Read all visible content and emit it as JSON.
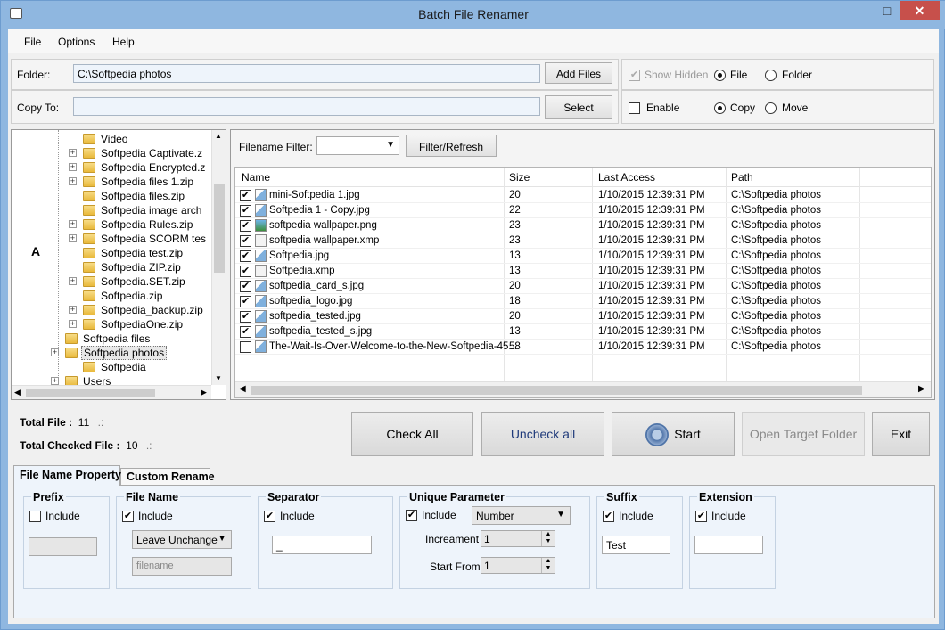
{
  "window": {
    "title": "Batch File Renamer",
    "min": "–",
    "max": "□",
    "close": "✕"
  },
  "menu": [
    "File",
    "Options",
    "Help"
  ],
  "folder": {
    "label": "Folder:",
    "value": "C:\\Softpedia photos",
    "add_button": "Add Files"
  },
  "copyto": {
    "label": "Copy To:",
    "value": "",
    "select_button": "Select"
  },
  "options": {
    "show_hidden": "Show Hidden",
    "file": "File",
    "folder": "Folder",
    "enable": "Enable",
    "copy": "Copy",
    "move": "Move"
  },
  "tree": {
    "marker": "A",
    "items": [
      {
        "label": "Video",
        "expander": false
      },
      {
        "label": "Softpedia Captivate.z",
        "expander": true
      },
      {
        "label": "Softpedia Encrypted.z",
        "expander": true
      },
      {
        "label": "Softpedia files 1.zip",
        "expander": true
      },
      {
        "label": "Softpedia files.zip",
        "expander": false
      },
      {
        "label": "Softpedia image arch",
        "expander": false
      },
      {
        "label": "Softpedia Rules.zip",
        "expander": true
      },
      {
        "label": "Softpedia SCORM tes",
        "expander": true
      },
      {
        "label": "Softpedia test.zip",
        "expander": false
      },
      {
        "label": "Softpedia ZIP.zip",
        "expander": false
      },
      {
        "label": "Softpedia.SET.zip",
        "expander": true
      },
      {
        "label": "Softpedia.zip",
        "expander": false
      },
      {
        "label": "Softpedia_backup.zip",
        "expander": true
      },
      {
        "label": "SoftpediaOne.zip",
        "expander": true
      },
      {
        "label": "Softpedia files",
        "expander": false
      },
      {
        "label": "Softpedia photos",
        "expander": true,
        "selected": true
      },
      {
        "label": "Softpedia",
        "expander": false
      },
      {
        "label": "Users",
        "expander": true
      }
    ]
  },
  "filter": {
    "label": "Filename Filter:",
    "value": "",
    "button": "Filter/Refresh"
  },
  "grid": {
    "columns": [
      "Name",
      "Size",
      "Last Access",
      "Path"
    ],
    "rows": [
      {
        "checked": true,
        "icon": "image-file-icon",
        "name": "mini-Softpedia 1.jpg",
        "size": "20",
        "access": "1/10/2015 12:39:31 PM",
        "path": "C:\\Softpedia photos"
      },
      {
        "checked": true,
        "icon": "image-file-icon",
        "name": "Softpedia 1 - Copy.jpg",
        "size": "22",
        "access": "1/10/2015 12:39:31 PM",
        "path": "C:\\Softpedia photos"
      },
      {
        "checked": true,
        "icon": "png-file-icon",
        "name": "softpedia wallpaper.png",
        "size": "23",
        "access": "1/10/2015 12:39:31 PM",
        "path": "C:\\Softpedia photos"
      },
      {
        "checked": true,
        "icon": "blank-file-icon",
        "name": "softpedia wallpaper.xmp",
        "size": "23",
        "access": "1/10/2015 12:39:31 PM",
        "path": "C:\\Softpedia photos"
      },
      {
        "checked": true,
        "icon": "image-file-icon",
        "name": "Softpedia.jpg",
        "size": "13",
        "access": "1/10/2015 12:39:31 PM",
        "path": "C:\\Softpedia photos"
      },
      {
        "checked": true,
        "icon": "blank-file-icon",
        "name": "Softpedia.xmp",
        "size": "13",
        "access": "1/10/2015 12:39:31 PM",
        "path": "C:\\Softpedia photos"
      },
      {
        "checked": true,
        "icon": "image-file-icon",
        "name": "softpedia_card_s.jpg",
        "size": "20",
        "access": "1/10/2015 12:39:31 PM",
        "path": "C:\\Softpedia photos"
      },
      {
        "checked": true,
        "icon": "image-file-icon",
        "name": "softpedia_logo.jpg",
        "size": "18",
        "access": "1/10/2015 12:39:31 PM",
        "path": "C:\\Softpedia photos"
      },
      {
        "checked": true,
        "icon": "image-file-icon",
        "name": "softpedia_tested.jpg",
        "size": "20",
        "access": "1/10/2015 12:39:31 PM",
        "path": "C:\\Softpedia photos"
      },
      {
        "checked": true,
        "icon": "image-file-icon",
        "name": "softpedia_tested_s.jpg",
        "size": "13",
        "access": "1/10/2015 12:39:31 PM",
        "path": "C:\\Softpedia photos"
      },
      {
        "checked": false,
        "icon": "image-file-icon",
        "name": "The-Wait-Is-Over-Welcome-to-the-New-Softpedia-45...",
        "size": "58",
        "access": "1/10/2015 12:39:31 PM",
        "path": "C:\\Softpedia photos"
      }
    ]
  },
  "stats": {
    "total_label": "Total File :",
    "total_value": "11",
    "checked_label": "Total Checked File :",
    "checked_value": "10",
    "grip": ".:"
  },
  "actions": {
    "check_all": "Check All",
    "uncheck_all": "Uncheck all",
    "start": "Start",
    "open_target": "Open Target Folder",
    "exit": "Exit"
  },
  "tabs": [
    "File Name Property",
    "Custom Rename"
  ],
  "groups": {
    "prefix": {
      "title": "Prefix",
      "include": "Include",
      "value": ""
    },
    "filename": {
      "title": "File Name",
      "include": "Include",
      "mode": "Leave Unchange",
      "placeholder": "filename"
    },
    "separator": {
      "title": "Separator",
      "include": "Include",
      "value": "_"
    },
    "unique": {
      "title": "Unique Parameter",
      "include": "Include",
      "type": "Number",
      "increment_label": "Increament",
      "increment": "1",
      "start_label": "Start From",
      "start": "1"
    },
    "suffix": {
      "title": "Suffix",
      "include": "Include",
      "value": "Test"
    },
    "extension": {
      "title": "Extension",
      "include": "Include",
      "value": ""
    }
  },
  "colors": {
    "titlebar": "#8fb7e0",
    "close": "#c7504b",
    "panel": "#eef4fb"
  }
}
